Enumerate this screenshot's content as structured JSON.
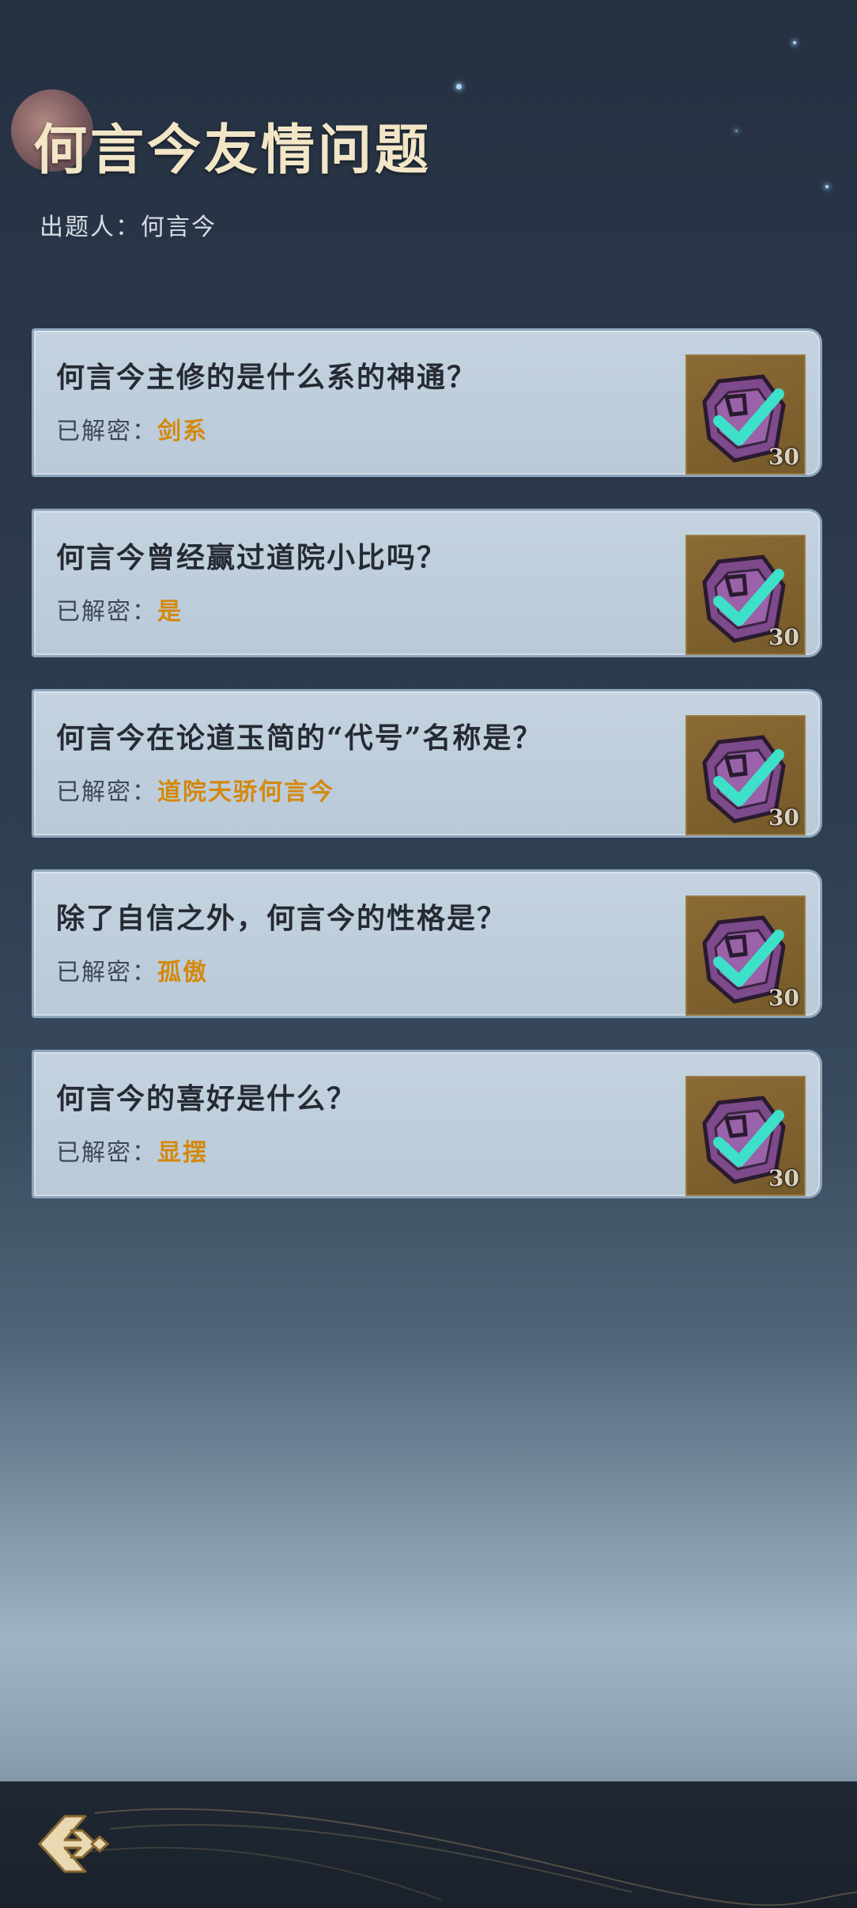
{
  "header": {
    "title": "何言今友情问题",
    "author_label": "出题人：",
    "author_name": "何言今"
  },
  "questions": [
    {
      "question": "何言今主修的是什么系的神通？",
      "answer_label": "已解密：",
      "answer": "剑系",
      "reward": "30",
      "icon": "check-token-icon"
    },
    {
      "question": "何言今曾经赢过道院小比吗？",
      "answer_label": "已解密：",
      "answer": "是",
      "reward": "30",
      "icon": "check-token-icon"
    },
    {
      "question": "何言今在论道玉简的“代号”名称是？",
      "answer_label": "已解密：",
      "answer": "道院天骄何言今",
      "reward": "30",
      "icon": "check-token-icon"
    },
    {
      "question": "除了自信之外，何言今的性格是？",
      "answer_label": "已解密：",
      "answer": "孤傲",
      "reward": "30",
      "icon": "check-token-icon"
    },
    {
      "question": "何言今的喜好是什么？",
      "answer_label": "已解密：",
      "answer": "显摆",
      "reward": "30",
      "icon": "check-token-icon"
    }
  ],
  "colors": {
    "answer": "#d4890e",
    "check": "#3de0c8",
    "title": "#f2e6c7"
  },
  "nav": {
    "back_icon": "back-arrow-icon"
  }
}
